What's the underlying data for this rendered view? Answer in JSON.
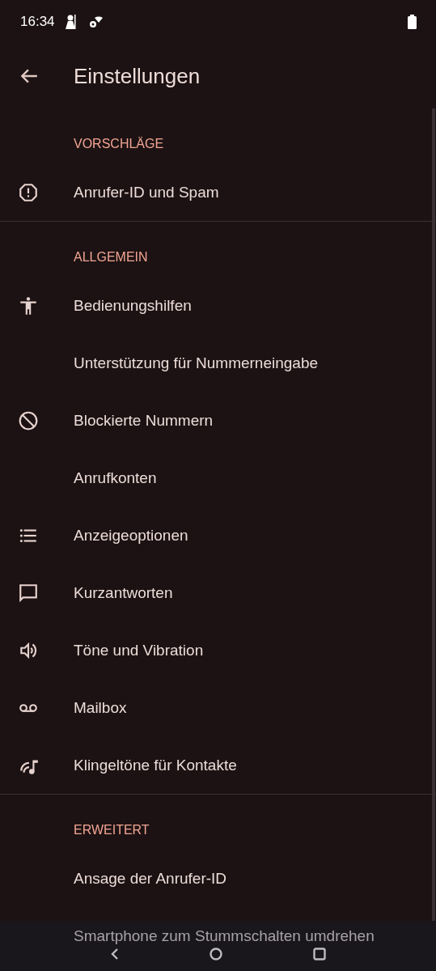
{
  "status_bar": {
    "time": "16:34"
  },
  "app_bar": {
    "title": "Einstellungen"
  },
  "sections": [
    {
      "header": "VORSCHLÄGE",
      "items": [
        {
          "label": "Anrufer-ID und Spam"
        }
      ]
    },
    {
      "header": "ALLGEMEIN",
      "items": [
        {
          "label": "Bedienungshilfen"
        },
        {
          "label": "Unterstützung für Nummerneingabe"
        },
        {
          "label": "Blockierte Nummern"
        },
        {
          "label": "Anrufkonten"
        },
        {
          "label": "Anzeigeoptionen"
        },
        {
          "label": "Kurzantworten"
        },
        {
          "label": "Töne und Vibration"
        },
        {
          "label": "Mailbox"
        },
        {
          "label": "Klingeltöne für Kontakte"
        }
      ]
    },
    {
      "header": "ERWEITERT",
      "items": [
        {
          "label": "Ansage der Anrufer-ID"
        },
        {
          "label": "Smartphone zum Stummschalten umdrehen"
        }
      ]
    }
  ]
}
